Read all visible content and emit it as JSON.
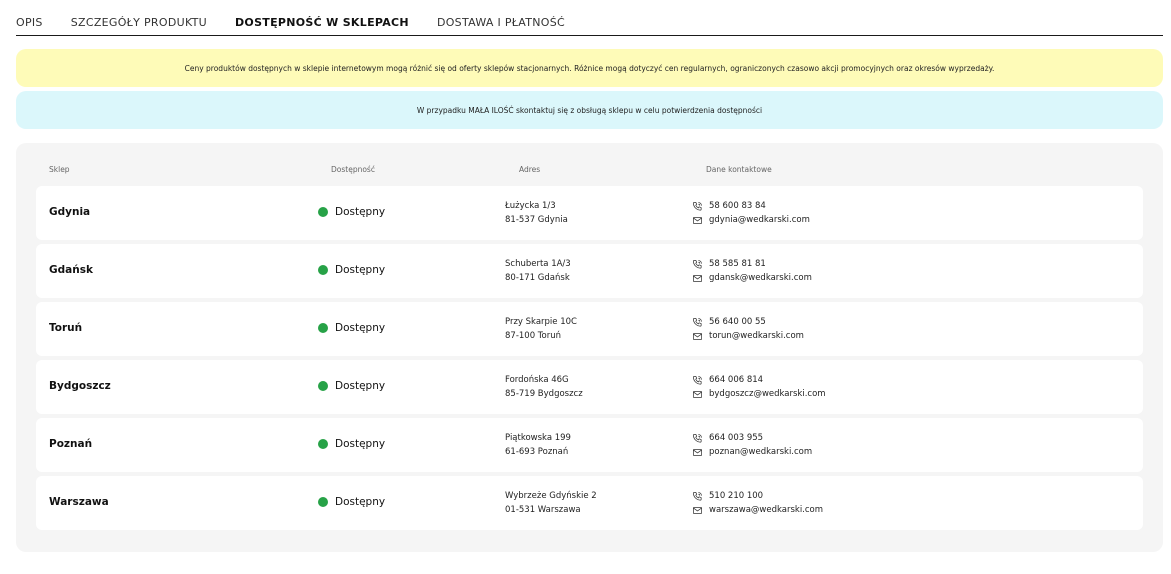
{
  "tabs": [
    {
      "label": "OPIS",
      "active": false
    },
    {
      "label": "SZCZEGÓŁY PRODUKTU",
      "active": false
    },
    {
      "label": "DOSTĘPNOŚĆ W SKLEPACH",
      "active": true
    },
    {
      "label": "DOSTAWA I PŁATNOŚĆ",
      "active": false
    }
  ],
  "notices": {
    "price_notice": "Ceny produktów dostępnych w sklepie internetowym mogą różnić się od oferty sklepów stacjonarnych. Różnice mogą dotyczyć cen regularnych, ograniczonych czasowo akcji promocyjnych oraz okresów wyprzedaży.",
    "stock_notice": "W przypadku MAŁA ILOŚĆ skontaktuj się z obsługą sklepu w celu potwierdzenia dostępności"
  },
  "table": {
    "headers": {
      "store": "Sklep",
      "availability": "Dostępność",
      "address": "Adres",
      "contact": "Dane kontaktowe"
    },
    "rows": [
      {
        "store": "Gdynia",
        "availability": "Dostępny",
        "street": "Łużycka 1/3",
        "city": "81-537 Gdynia",
        "phone": "58 600 83 84",
        "email": "gdynia@wedkarski.com"
      },
      {
        "store": "Gdańsk",
        "availability": "Dostępny",
        "street": "Schuberta 1A/3",
        "city": "80-171 Gdańsk",
        "phone": "58 585 81 81",
        "email": "gdansk@wedkarski.com"
      },
      {
        "store": "Toruń",
        "availability": "Dostępny",
        "street": "Przy Skarpie 10C",
        "city": "87-100 Toruń",
        "phone": "56 640 00 55",
        "email": "torun@wedkarski.com"
      },
      {
        "store": "Bydgoszcz",
        "availability": "Dostępny",
        "street": "Fordońska 46G",
        "city": "85-719 Bydgoszcz",
        "phone": "664 006 814",
        "email": "bydgoszcz@wedkarski.com"
      },
      {
        "store": "Poznań",
        "availability": "Dostępny",
        "street": "Piątkowska 199",
        "city": "61-693 Poznań",
        "phone": "664 003 955",
        "email": "poznan@wedkarski.com"
      },
      {
        "store": "Warszawa",
        "availability": "Dostępny",
        "street": "Wybrzeże Gdyńskie 2",
        "city": "01-531 Warszawa",
        "phone": "510 210 100",
        "email": "warszawa@wedkarski.com"
      }
    ]
  },
  "colors": {
    "available_dot": "#27a247",
    "price_notice_bg": "#fefbb8",
    "stock_notice_bg": "#dbf7fb",
    "panel_bg": "#f5f5f5"
  },
  "icons": {
    "phone": "phone-icon",
    "email": "envelope-icon",
    "status": "status-dot-icon"
  }
}
